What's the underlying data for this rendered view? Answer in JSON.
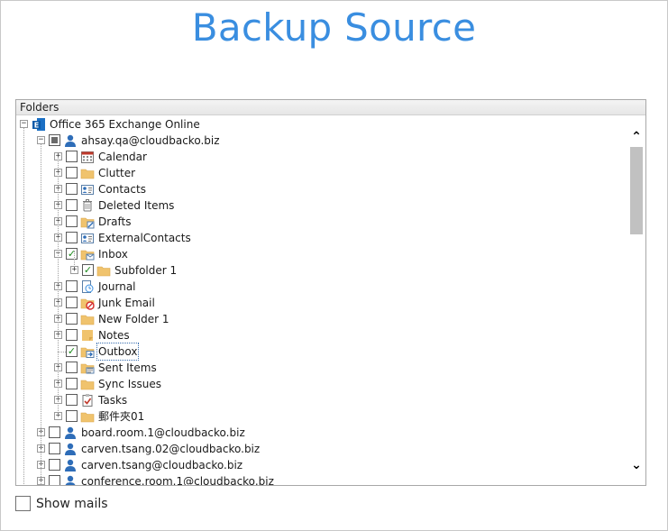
{
  "title": "Backup Source",
  "panel": {
    "header": "Folders"
  },
  "tree": {
    "root": {
      "label": "Office 365 Exchange Online",
      "icon": "exchange-icon"
    },
    "user": {
      "label": "ahsay.qa@cloudbacko.biz",
      "icon": "user-icon"
    },
    "folders": [
      {
        "label": "Calendar",
        "icon": "calendar-icon",
        "checked": false,
        "expandable": true
      },
      {
        "label": "Clutter",
        "icon": "folder-icon",
        "checked": false,
        "expandable": true
      },
      {
        "label": "Contacts",
        "icon": "contact-card-icon",
        "checked": false,
        "expandable": true
      },
      {
        "label": "Deleted Items",
        "icon": "trash-icon",
        "checked": false,
        "expandable": true
      },
      {
        "label": "Drafts",
        "icon": "drafts-folder-icon",
        "checked": false,
        "expandable": true
      },
      {
        "label": "ExternalContacts",
        "icon": "contact-card-icon",
        "checked": false,
        "expandable": true
      },
      {
        "label": "Inbox",
        "icon": "inbox-folder-icon",
        "checked": true,
        "expandable": true,
        "expanded": true
      },
      {
        "label": "Subfolder 1",
        "icon": "folder-icon",
        "checked": true,
        "expandable": true,
        "child": true
      },
      {
        "label": "Journal",
        "icon": "journal-icon",
        "checked": false,
        "expandable": true
      },
      {
        "label": "Junk Email",
        "icon": "junk-folder-icon",
        "checked": false,
        "expandable": true
      },
      {
        "label": "New Folder 1",
        "icon": "folder-icon",
        "checked": false,
        "expandable": true
      },
      {
        "label": "Notes",
        "icon": "notes-icon",
        "checked": false,
        "expandable": true
      },
      {
        "label": "Outbox",
        "icon": "outbox-folder-icon",
        "checked": true,
        "expandable": false,
        "selected": true
      },
      {
        "label": "Sent Items",
        "icon": "sent-folder-icon",
        "checked": false,
        "expandable": true
      },
      {
        "label": "Sync Issues",
        "icon": "folder-icon",
        "checked": false,
        "expandable": true
      },
      {
        "label": "Tasks",
        "icon": "tasks-icon",
        "checked": false,
        "expandable": true
      },
      {
        "label": "郵件夾01",
        "icon": "folder-icon",
        "checked": false,
        "expandable": true
      }
    ],
    "other_users": [
      {
        "label": "board.room.1@cloudbacko.biz",
        "icon": "user-icon"
      },
      {
        "label": "carven.tsang.02@cloudbacko.biz",
        "icon": "user-icon"
      },
      {
        "label": "carven.tsang@cloudbacko.biz",
        "icon": "user-icon"
      },
      {
        "label": "conference.room.1@cloudbacko.biz",
        "icon": "user-icon"
      }
    ]
  },
  "show_mails": {
    "label": "Show mails",
    "checked": false
  },
  "colors": {
    "title": "#3a8ee0",
    "folder": "#f0c36d",
    "user": "#2e6db8",
    "check": "#1a8a1a"
  }
}
